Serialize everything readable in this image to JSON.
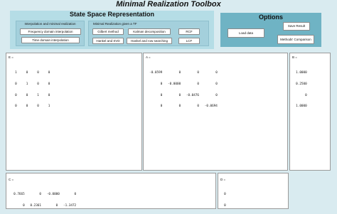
{
  "window": {
    "title": "Minimal Realization Toolbox"
  },
  "state_space_panel": {
    "title": "State Space Representation",
    "interpolation_group": {
      "title": "Interpolation and minimal realization",
      "buttons": [
        "Frequency domain interpolation",
        "Time domain interpolation"
      ]
    },
    "tf_group": {
      "title": "Minimal Realization given a TF",
      "buttons": [
        "Gilbert method",
        "Kalman decomposition",
        "RCF",
        "Hankel and SVD",
        "Hankel and row searching",
        "LCF"
      ]
    }
  },
  "options_panel": {
    "title": "Options",
    "load_button": "Load data",
    "save_button": "Save Result",
    "compare_button": "Methods' Comparison"
  },
  "matrices": {
    "E": {
      "label": "E =",
      "rows": [
        "  1     0     0     0",
        "  0     1     0     0",
        "  0     0     1     0",
        "  0     0     0     1"
      ]
    },
    "A": {
      "label": "A =",
      "rows": [
        "  -0.0599         0         0         0",
        "        0   -0.0000         0         0",
        "        0         0   -0.0476         0",
        "        0         0         0   -0.0694"
      ]
    },
    "B": {
      "label": "B =",
      "rows": [
        "  1.0000",
        "  0.2500",
        "       0",
        "  1.0000"
      ]
    },
    "C": {
      "label": "C =",
      "rows": [
        "  0.7665        0   -0.0000        0",
        "       0   0.2361        0   -1.3472"
      ]
    },
    "D": {
      "label": "D =",
      "rows": [
        "  0",
        "  0"
      ]
    }
  }
}
